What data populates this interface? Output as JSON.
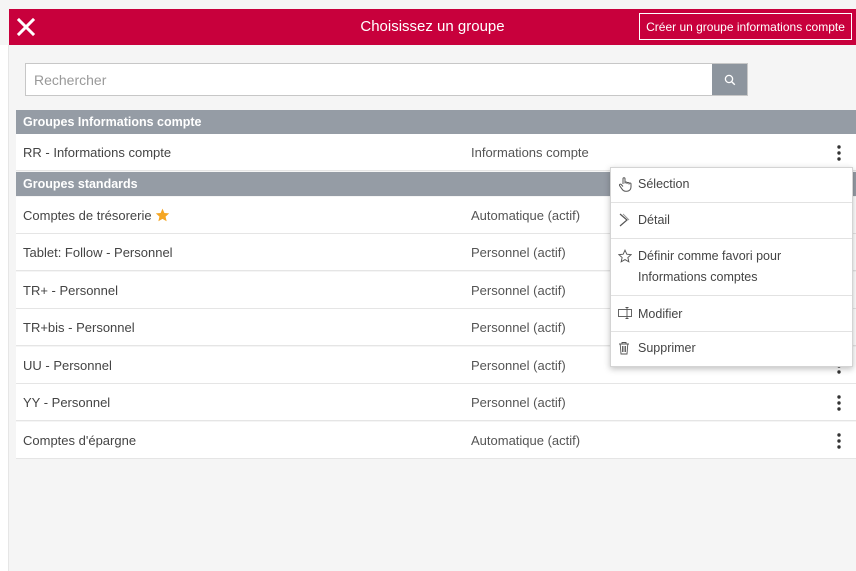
{
  "header": {
    "title": "Choisissez un groupe",
    "create_button": "Créer un groupe informations compte"
  },
  "search": {
    "placeholder": "Rechercher",
    "value": ""
  },
  "groups": [
    {
      "header": "Groupes Informations compte",
      "rows": [
        {
          "name": "RR - Informations compte",
          "type": "Informations compte",
          "favorite": false
        }
      ]
    },
    {
      "header": "Groupes standards",
      "rows": [
        {
          "name": "Comptes de trésorerie",
          "type": "Automatique (actif)",
          "favorite": true
        },
        {
          "name": "Tablet: Follow - Personnel",
          "type": "Personnel (actif)",
          "favorite": false
        },
        {
          "name": "TR+ - Personnel",
          "type": "Personnel (actif)",
          "favorite": false
        },
        {
          "name": "TR+bis - Personnel",
          "type": "Personnel (actif)",
          "favorite": false
        },
        {
          "name": "UU - Personnel",
          "type": "Personnel (actif)",
          "favorite": false
        },
        {
          "name": "YY - Personnel",
          "type": "Personnel (actif)",
          "favorite": false
        },
        {
          "name": "Comptes d'épargne",
          "type": "Automatique (actif)",
          "favorite": false
        }
      ]
    }
  ],
  "context_menu": {
    "items": [
      {
        "label": "Sélection",
        "icon": "hand-pointer-icon"
      },
      {
        "label": "Détail",
        "icon": "chevron-right-icon"
      },
      {
        "label": "Définir comme favori pour",
        "label_line2": "Informations comptes",
        "icon": "star-outline-icon"
      },
      {
        "label": "Modifier",
        "icon": "edit-icon"
      },
      {
        "label": "Supprimer",
        "icon": "trash-icon"
      }
    ]
  },
  "colors": {
    "brand": "#c8003c",
    "group_header": "#959ca5",
    "search_button": "#8d959e",
    "favorite_star": "#f5a623"
  }
}
